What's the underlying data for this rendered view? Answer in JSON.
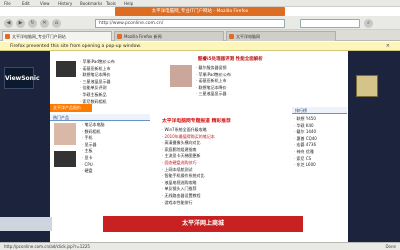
{
  "browser": {
    "bookmarks": [
      "File",
      "Edit",
      "View",
      "History",
      "Bookmarks",
      "Tools",
      "Help"
    ],
    "window_title": "太平洋电脑网_专业IT门户网站 - Mozilla Firefox",
    "url": "http://www.pconline.com.cn/",
    "tabs": [
      {
        "label": "太平洋电脑网_专业IT门户网站"
      },
      {
        "label": "Mozilla Firefox 新闻"
      },
      {
        "label": "太平洋电脑网"
      }
    ],
    "notification": "Firefox prevented this site from opening a pop-up window.",
    "notification_close": "×",
    "status": "http://pconline.com.cn/ad/click.jsp?r=1225",
    "status_right": "Done"
  },
  "page": {
    "left_promo": "ViewSonic",
    "top_headline": "酷睿i5处理器评测 性能全面解析",
    "top_news": [
      "苹果iPad售价公布",
      "诺基亚新机上市",
      "联想笔记本降价",
      "三星液晶显示器",
      "佳能单反评测",
      "华硕主板新品",
      "索尼数码相机",
      "戴尔服务器促销"
    ],
    "orange_label": "太平洋产品报价",
    "left_section": "热门产品",
    "left_list": [
      "笔记本电脑",
      "数码相机",
      "手机",
      "显示器",
      "主板",
      "显卡",
      "CPU",
      "硬盘"
    ],
    "center_red_title": "太平洋电脑网专题报道 精彩推荐",
    "center_list": [
      "Win7系统全面升级攻略",
      "2010年最值得购买的笔记本",
      "高清摄像头横向对比",
      "家庭影院组建指南",
      "主流显卡天梯图更新",
      "固态硬盘选购技巧",
      "上网本续航测试",
      "智能手机操作系统对比",
      "液晶电视选购攻略",
      "单反镜头入门推荐",
      "无线路由器设置教程",
      "游戏本性能排行"
    ],
    "right_section": "排行榜",
    "right_list": [
      "联想 Y450",
      "华硕 K40",
      "戴尔 1440",
      "惠普 CQ40",
      "宏碁 4736",
      "神舟 优雅",
      "索尼 CS",
      "东芝 L600"
    ],
    "footer_ad": "太平洋网上商城"
  }
}
